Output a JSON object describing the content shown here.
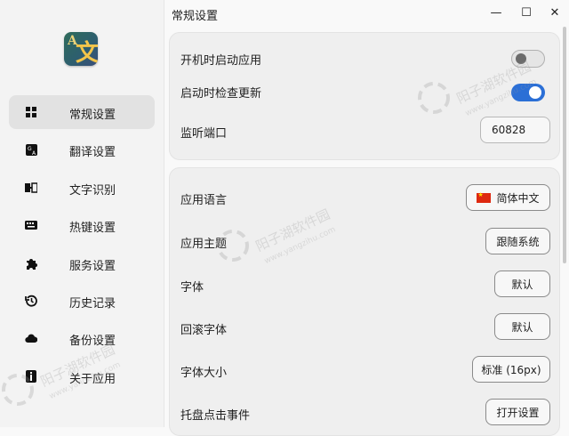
{
  "window": {
    "title": "常规设置",
    "controls": {
      "minimize": "—",
      "maximize": "☐",
      "close": "✕"
    }
  },
  "app": {
    "logo_glyph_small": "A",
    "logo_glyph_large": "文"
  },
  "sidebar": {
    "items": [
      {
        "label": "常规设置",
        "icon": "grid-icon",
        "active": true
      },
      {
        "label": "翻译设置",
        "icon": "translate-icon",
        "active": false
      },
      {
        "label": "文字识别",
        "icon": "ocr-icon",
        "active": false
      },
      {
        "label": "热键设置",
        "icon": "keyboard-icon",
        "active": false
      },
      {
        "label": "服务设置",
        "icon": "puzzle-icon",
        "active": false
      },
      {
        "label": "历史记录",
        "icon": "history-icon",
        "active": false
      },
      {
        "label": "备份设置",
        "icon": "cloud-icon",
        "active": false
      },
      {
        "label": "关于应用",
        "icon": "info-icon",
        "active": false
      }
    ]
  },
  "general": {
    "autostart_label": "开机时启动应用",
    "autostart_on": false,
    "check_update_label": "启动时检查更新",
    "check_update_on": true,
    "port_label": "监听端口",
    "port_value": "60828"
  },
  "appearance": {
    "language_label": "应用语言",
    "language_value": "简体中文",
    "theme_label": "应用主题",
    "theme_value": "跟随系统",
    "font_label": "字体",
    "font_value": "默认",
    "fallback_font_label": "回滚字体",
    "fallback_font_value": "默认",
    "font_size_label": "字体大小",
    "font_size_value": "标准 (16px)",
    "tray_click_label": "托盘点击事件",
    "tray_click_value": "打开设置"
  },
  "colors": {
    "accent": "#2b6fd6",
    "sidebar_bg": "#f3f3f3",
    "active_item_bg": "#e2e2e2"
  },
  "watermark": {
    "cn": "阳子湖软件园",
    "en": "www.yangzihu.com"
  }
}
